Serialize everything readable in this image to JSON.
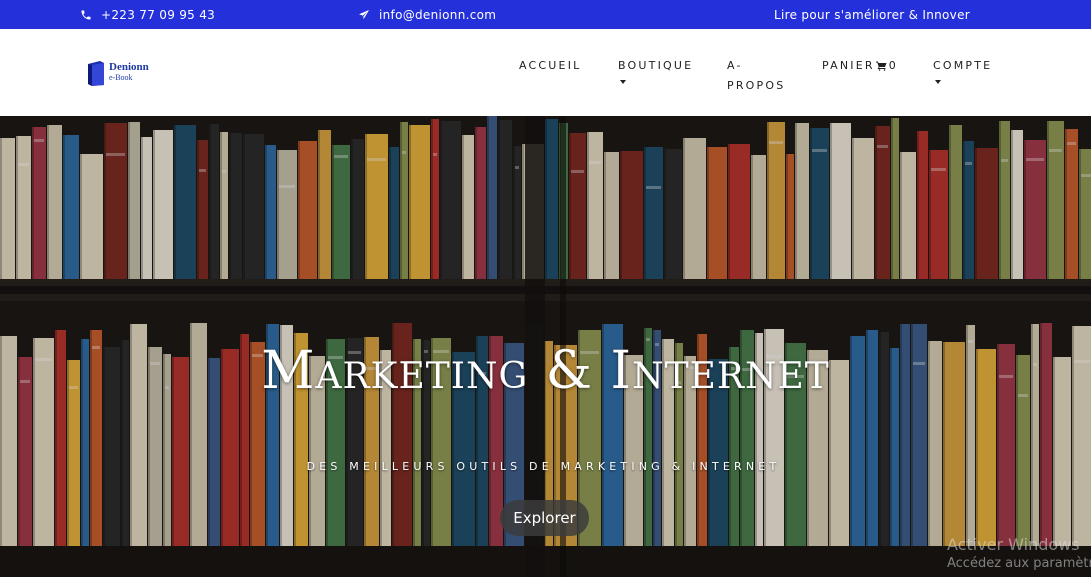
{
  "topbar": {
    "phone": "+223 77 09 95 43",
    "email": "info@denionn.com",
    "tagline": "Lire pour s'améliorer & Innover",
    "background": "#2430d9"
  },
  "logo": {
    "brand": "Denionn",
    "sub": "e-Book",
    "icon": "book-icon"
  },
  "nav": {
    "accueil": "ACCUEIL",
    "boutique": "BOUTIQUE",
    "apropos_line1": "A-",
    "apropos_line2": "PROPOS",
    "panier": "PANIER",
    "cart_count": "0",
    "compte": "COMPTE"
  },
  "hero": {
    "title": "Marketing & Internet",
    "subtitle": "DES MEILLEURS OUTILS DE MARKETING & INTERNET",
    "button": "Explorer"
  },
  "watermark": {
    "line1": "Activer Windows",
    "line2": "Accédez aux paramètres"
  }
}
